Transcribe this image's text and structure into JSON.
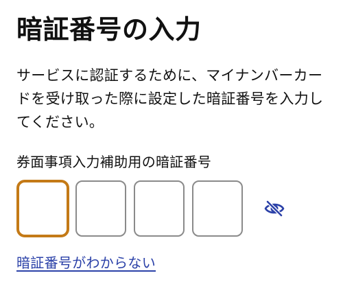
{
  "title": "暗証番号の入力",
  "description": "サービスに認証するために、マイナンバーカードを受け取った際に設定した暗証番号を入力してください。",
  "pin_field": {
    "label": "券面事項入力補助用の暗証番号",
    "digits": [
      "",
      "",
      "",
      ""
    ],
    "focused_index": 0,
    "visibility_toggle_icon": "eye-off-icon"
  },
  "help_link": "暗証番号がわからない",
  "colors": {
    "accent_focus": "#c47a17",
    "link": "#2b41a8",
    "box_border": "#8a8a8a"
  }
}
